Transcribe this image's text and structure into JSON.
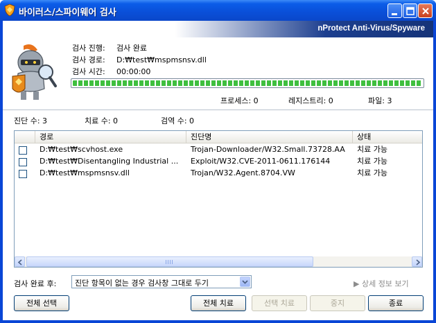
{
  "window": {
    "title": "바이러스/스파이웨어 검사"
  },
  "brand": {
    "text": "nProtect Anti-Virus/Spyware"
  },
  "scan": {
    "progress_label": "검사 진행:",
    "progress_value": "검사 완료",
    "path_label": "검사 경로:",
    "path_value": "D:₩test₩mspmsnsv.dll",
    "time_label": "검사 시간:",
    "time_value": "00:00:00",
    "progress_fraction": 1.0
  },
  "counts": {
    "process": "프로세스: 0",
    "registry": "레지스트리: 0",
    "file": "파일: 3"
  },
  "summary": {
    "detected": "진단 수: 3",
    "treated": "치료 수: 0",
    "quarantined": "검역 수: 0"
  },
  "list": {
    "columns": [
      "경로",
      "진단명",
      "상태"
    ],
    "rows": [
      {
        "path": "D:₩test₩scvhost.exe",
        "name": "Trojan-Downloader/W32.Small.73728.AA",
        "status": "치료 가능"
      },
      {
        "path": "D:₩test₩Disentangling Industrial ...",
        "name": "Exploit/W32.CVE-2011-0611.176144",
        "status": "치료 가능"
      },
      {
        "path": "D:₩test₩mspmsnsv.dll",
        "name": "Trojan/W32.Agent.8704.VW",
        "status": "치료 가능"
      }
    ]
  },
  "after": {
    "label": "검사 완료 후:",
    "selected": "진단 항목이 없는 경우 검사창 그대로 두기"
  },
  "detail_link": "▶ 상세 정보 보기",
  "buttons": {
    "select_all": "전체 선택",
    "treat_all": "전체 치료",
    "treat_selected": "선택 치료",
    "stop": "중지",
    "exit": "종료"
  },
  "colors": {
    "title_blue": "#0a4fd8",
    "progress_green": "#3fbf3f",
    "brand_navy": "#153378"
  }
}
